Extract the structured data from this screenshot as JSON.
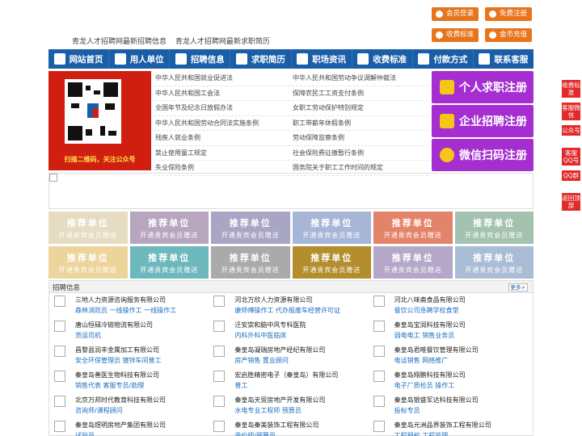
{
  "top": {
    "links": [
      "青龙人才招聘网最新招聘信息",
      "青龙人才招聘网最新求职简历"
    ],
    "buttons": [
      "会员登录",
      "免费注册",
      "收费标准",
      "金币充值"
    ]
  },
  "nav": [
    "网站首页",
    "用人单位",
    "招聘信息",
    "求职简历",
    "职场资讯",
    "收费标准",
    "付款方式",
    "联系客服"
  ],
  "qr": {
    "caption": "扫描二维码，关注公众号"
  },
  "laws": [
    [
      "中华人民共和国就业促进法",
      "中华人民共和国劳动争议调解仲裁法"
    ],
    [
      "中华人民共和国工会法",
      "保障农民工工资支付条例"
    ],
    [
      "全国年节及纪念日放假办法",
      "女职工劳动保护特别规定"
    ],
    [
      "中华人民共和国劳动合同法实施条例",
      "职工带薪年休假条例"
    ],
    [
      "残疾人就业条例",
      "劳动保障监察条例"
    ],
    [
      "禁止使用童工规定",
      "社会保险费征缴暂行条例"
    ],
    [
      "失业保险条例",
      "国务院关于职工工作时间的规定"
    ]
  ],
  "register": [
    "个人求职注册",
    "企业招聘注册",
    "微信扫码注册"
  ],
  "side": [
    "收费标准",
    "客服微信",
    "公众号",
    "客服QQ号",
    "QQ群",
    "返回顶部"
  ],
  "rec": {
    "title": "推荐单位",
    "sub": "开通贵宾会员赠送"
  },
  "rec_colors": [
    "#e6dcc2",
    "#b7a6bd",
    "#a8a6c4",
    "#a7b6d6",
    "#e3846a",
    "#a4c2b0",
    "#ecd49a",
    "#6cb8bd",
    "#aaaaaa",
    "#b48d2d",
    "#b4a7c8",
    "#aabdd6"
  ],
  "jobs": {
    "title": "招聘信息",
    "more": "更多>",
    "items": [
      {
        "co": "三地人力资源咨询服务有限公司",
        "ps": "森林消防员 一线操作工 一线操作工"
      },
      {
        "co": "河北万欣人力资源有限公司",
        "ps": "康师傅操作工 代办报废车经营许可证"
      },
      {
        "co": "河北八味斋食品有限公司",
        "ps": "餐饮公司急聘学校食堂"
      },
      {
        "co": "唐山恒碌冷链物流有限公司",
        "ps": "货运司机"
      },
      {
        "co": "迁安崇和脑中风专科医院",
        "ps": "内科外科中医临床"
      },
      {
        "co": "秦皇岛宝润科技有限公司",
        "ps": "弱电电工 销售业务员"
      },
      {
        "co": "昌黎县润丰金属加工有限公司",
        "ps": "安全环保管理员 镀锌车间普工"
      },
      {
        "co": "秦皇岛凝瑞房地产经纪有限公司",
        "ps": "房产销售 置业顾问"
      },
      {
        "co": "秦皇岛君唯餐饮管理有限公司",
        "ps": "电话销售 网络推广"
      },
      {
        "co": "秦皇岛善医生物科技有限公司",
        "ps": "销售代表 客服专员/助理"
      },
      {
        "co": "宏启胜精密电子（秦皇岛）有限公司",
        "ps": "普工"
      },
      {
        "co": "秦皇岛翔鹏科技有限公司",
        "ps": "电子厂质检员 操作工"
      },
      {
        "co": "北京万邦时代教育科技有限公司",
        "ps": "咨询师/课程顾问"
      },
      {
        "co": "秦皇岛天贸房地产开发有限公司",
        "ps": "水电专业工程师 预算员"
      },
      {
        "co": "秦皇岛银盛军达科技有限公司",
        "ps": "投标专员"
      },
      {
        "co": "秦皇岛煜明房地产集团有限公司",
        "ps": "试验员"
      },
      {
        "co": "秦皇岛秦美装饰工程有限公司",
        "ps": "造价师/预算员"
      },
      {
        "co": "秦皇岛元洲品界装饰工程有限公司",
        "ps": "工程预校 工程监理"
      }
    ]
  }
}
